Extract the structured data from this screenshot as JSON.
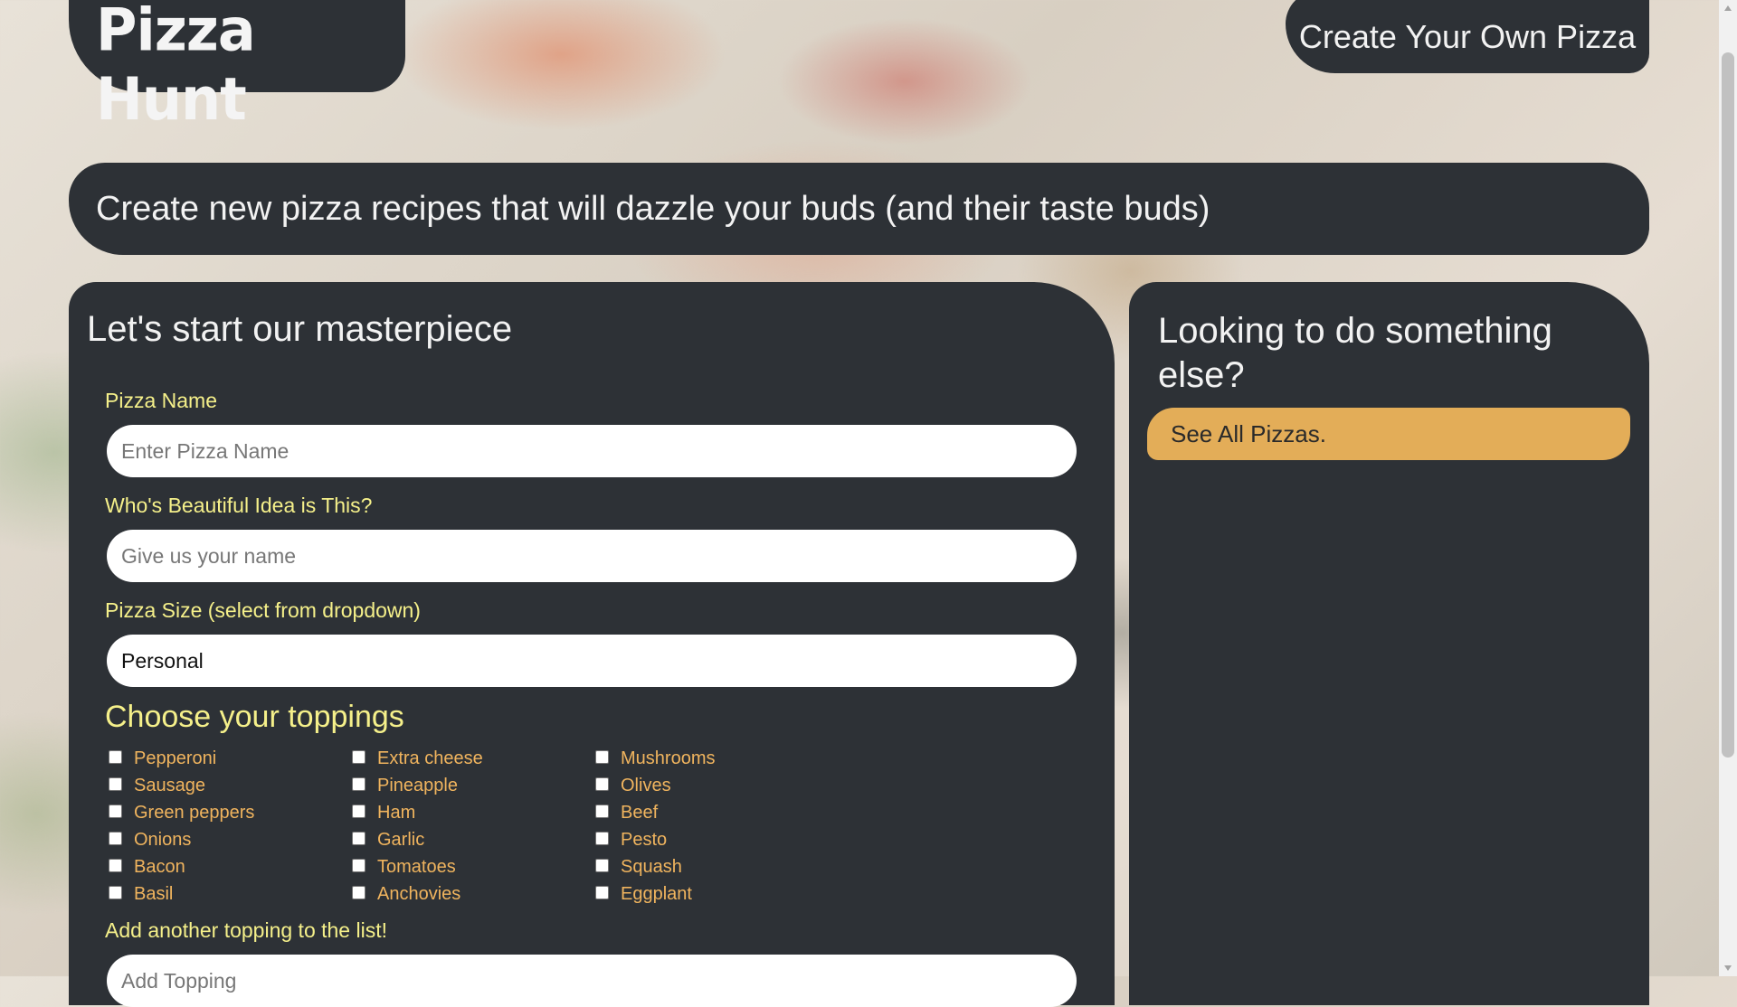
{
  "header": {
    "logo_text": "Pizza Hunt",
    "create_button": "Create Your Own Pizza"
  },
  "tagline": "Create new pizza recipes that will dazzle your buds (and their taste buds)",
  "form": {
    "title": "Let's start our masterpiece",
    "pizza_name": {
      "label": "Pizza Name",
      "placeholder": "Enter Pizza Name"
    },
    "created_by": {
      "label": "Who's Beautiful Idea is This?",
      "placeholder": "Give us your name"
    },
    "size": {
      "label": "Pizza Size (select from dropdown)",
      "value": "Personal"
    },
    "toppings_heading": "Choose your toppings",
    "toppings": [
      "Pepperoni",
      "Extra cheese",
      "Mushrooms",
      "Sausage",
      "Pineapple",
      "Olives",
      "Green peppers",
      "Ham",
      "Beef",
      "Onions",
      "Garlic",
      "Pesto",
      "Bacon",
      "Tomatoes",
      "Squash",
      "Basil",
      "Anchovies",
      "Eggplant"
    ],
    "new_topping": {
      "label": "Add another topping to the list!",
      "placeholder": "Add Topping"
    }
  },
  "sidebar": {
    "title": "Looking to do something else?",
    "see_all_button": "See All Pizzas."
  },
  "colors": {
    "panel": "#2d3136",
    "label_yellow": "#f5f08a",
    "topping_orange": "#f0b45e",
    "button_gold": "#e3ad58"
  }
}
